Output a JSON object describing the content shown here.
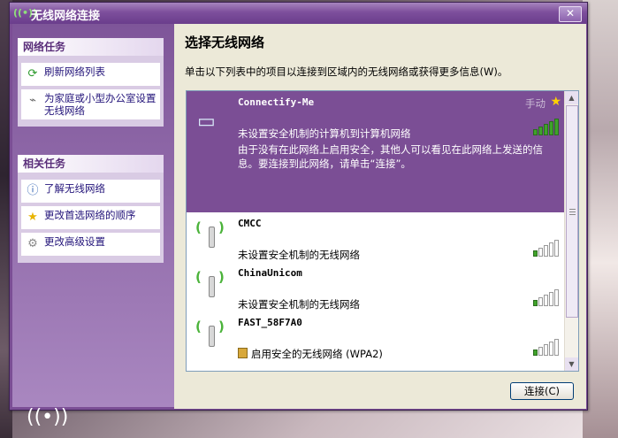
{
  "window": {
    "title": "无线网络连接",
    "close_label": "✕"
  },
  "left": {
    "network_tasks": {
      "header": "网络任务",
      "items": [
        {
          "label": "刷新网络列表",
          "icon": "refresh-icon"
        },
        {
          "label": "为家庭或小型办公室设置无线网络",
          "icon": "wireless-setup-icon"
        }
      ]
    },
    "related_tasks": {
      "header": "相关任务",
      "items": [
        {
          "label": "了解无线网络",
          "icon": "info-icon"
        },
        {
          "label": "更改首选网络的顺序",
          "icon": "star-icon"
        },
        {
          "label": "更改高级设置",
          "icon": "settings-icon"
        }
      ]
    }
  },
  "main": {
    "heading": "选择无线网络",
    "description": "单击以下列表中的项目以连接到区域内的无线网络或获得更多信息(W)。",
    "networks": [
      {
        "name": "Connectify-Me",
        "security": "未设置安全机制的计算机到计算机网络",
        "info": "由于没有在此网络上启用安全，其他人可以看见在此网络上发送的信息。要连接到此网络，请单击“连接”。",
        "manual": "手动",
        "signal_bars": 5
      },
      {
        "name": "CMCC",
        "security": "未设置安全机制的无线网络",
        "signal_bars": 1
      },
      {
        "name": "ChinaUnicom",
        "security": "未设置安全机制的无线网络",
        "signal_bars": 1
      },
      {
        "name": "FAST_58F7A0",
        "security": "启用安全的无线网络 (WPA2)",
        "signal_bars": 1
      }
    ],
    "connect_label": "连接(C)"
  },
  "colors": {
    "accent": "#7b4e95",
    "signal": "#3fa32a"
  }
}
